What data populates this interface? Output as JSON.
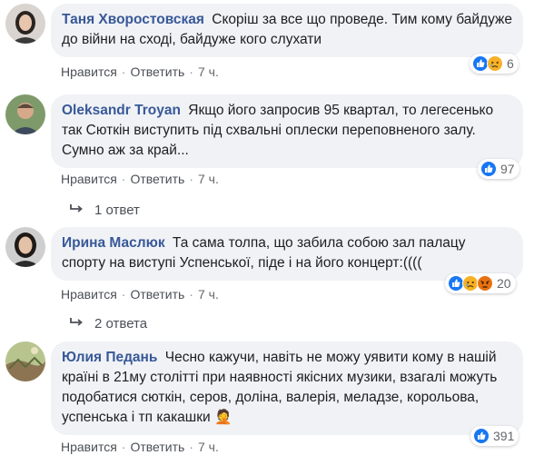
{
  "comments": [
    {
      "author": "Таня Хворостовская",
      "text": "Скоріш за все що проведе. Тим кому байдуже до війни на сході, байдуже кого слухати",
      "like_label": "Нравится",
      "reply_label": "Ответить",
      "time": "7 ч.",
      "reactions": [
        "like-icon",
        "sad-icon"
      ],
      "reaction_count": "6"
    },
    {
      "author": "Oleksandr Troyan",
      "text": "Якщо його запросив 95 квартал, то легесенько так Сюткін виступить під схвальні оплески переповненого залу. Сумно аж за край...",
      "like_label": "Нравится",
      "reply_label": "Ответить",
      "time": "7 ч.",
      "reactions": [
        "like-icon"
      ],
      "reaction_count": "97",
      "replies_label": "1 ответ"
    },
    {
      "author": "Ирина Маслюк",
      "text": "Та сама толпа, що забила собою зал палацу спорту на виступі Успенської, піде і на його концерт:((((",
      "like_label": "Нравится",
      "reply_label": "Ответить",
      "time": "7 ч.",
      "reactions": [
        "like-icon",
        "sad-icon",
        "angry-icon"
      ],
      "reaction_count": "20",
      "replies_label": "2 ответа"
    },
    {
      "author": "Юлия Педань",
      "text": "Чесно кажучи, навіть не можу уявити кому в нашій країні в 21му столітті при наявності якісних музики, взагалі можуть подобатися сюткін, серов, доліна, валерія, меладзе, корольова, успенська і тп какашки 🤦",
      "like_label": "Нравится",
      "reply_label": "Ответить",
      "time": "7 ч.",
      "reactions": [
        "like-icon"
      ],
      "reaction_count": "391"
    }
  ],
  "colors": {
    "author": "#385898",
    "bubble": "#f0f2f5",
    "like": "#1877f2",
    "sad": "#f7b125",
    "angry": "#e9710f"
  }
}
